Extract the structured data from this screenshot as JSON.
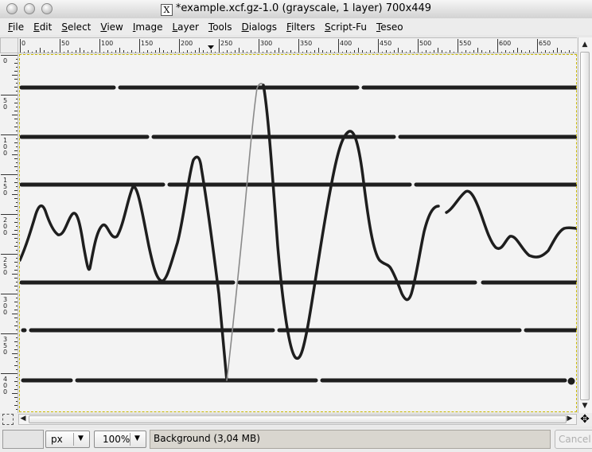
{
  "window": {
    "title": "*example.xcf.gz-1.0 (grayscale, 1 layer) 700x449",
    "x_icon_glyph": "X"
  },
  "menu": [
    "File",
    "Edit",
    "Select",
    "View",
    "Image",
    "Layer",
    "Tools",
    "Dialogs",
    "Filters",
    "Script-Fu",
    "Teseo"
  ],
  "rulers": {
    "horizontal_labels": [
      "0",
      "50",
      "100",
      "150",
      "200",
      "250",
      "300",
      "350",
      "400",
      "450",
      "500",
      "550",
      "600",
      "650"
    ],
    "vertical_labels": [
      "0",
      "50",
      "100",
      "150",
      "200",
      "250",
      "300",
      "350",
      "400"
    ]
  },
  "statusbar": {
    "unit": "px",
    "zoom": "100%",
    "message": "Background (3,04 MB)",
    "cancel_label": "Cancel"
  },
  "icons": {
    "dropdown": "▼",
    "scroll_up": "▲",
    "scroll_down": "▼",
    "scroll_left": "◀",
    "scroll_right": "▶",
    "navigate": "✥"
  }
}
